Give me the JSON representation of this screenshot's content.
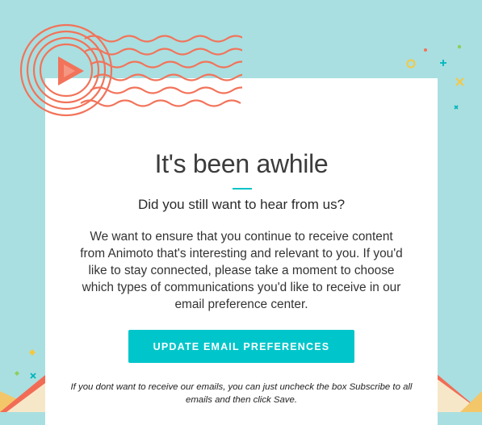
{
  "email": {
    "headline": "It's been awhile",
    "subheadline": "Did you still want to hear from us?",
    "body": "We want to ensure that you continue to receive content from Animoto that's interesting and relevant to you. If you'd like to stay connected, please take a moment to choose which types of communications you'd like to receive in our email preference center.",
    "cta_label": "UPDATE EMAIL PREFERENCES",
    "footnote": "If you dont want to receive our emails, you can just uncheck the box Subscribe to all emails and then click Save."
  },
  "decor": {
    "stamp_icon": "animoto-play-stamp-icon",
    "envelope_icon": "envelope-icon",
    "confetti_icon": "confetti-icon"
  },
  "colors": {
    "background": "#a9dfe0",
    "accent": "#00c6cb",
    "stamp": "#f2735a",
    "card": "#ffffff"
  }
}
